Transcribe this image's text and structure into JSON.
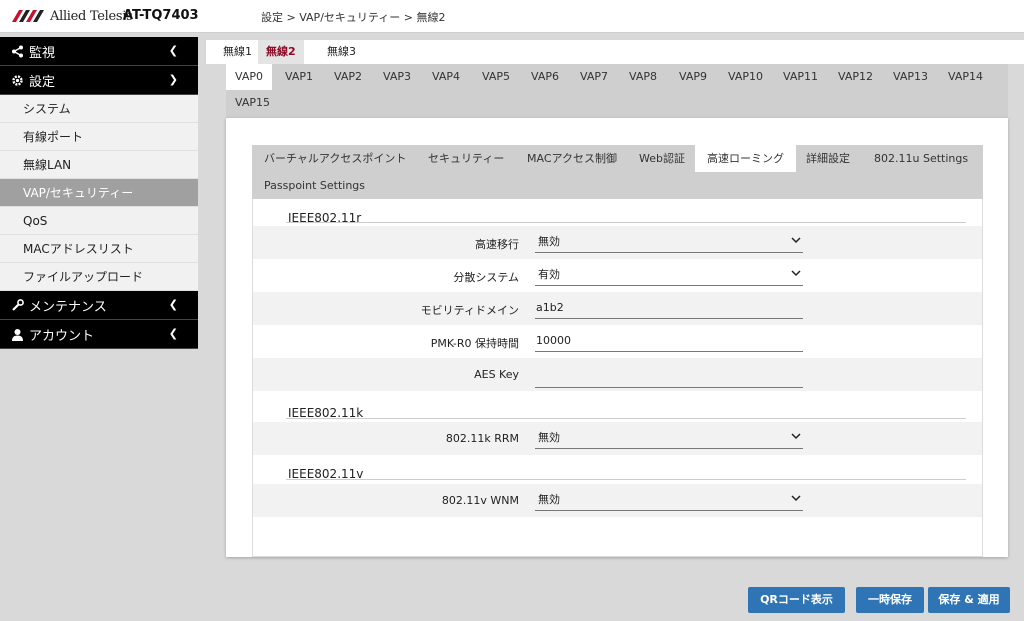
{
  "header": {
    "logo_text": "Allied Telesis",
    "model": "AT-TQ7403",
    "breadcrumb": "設定 > VAP/セキュリティー > 無線2"
  },
  "sidebar": {
    "groups": [
      {
        "label": "監視",
        "icon": "share-icon"
      },
      {
        "label": "設定",
        "icon": "gear-icon"
      },
      {
        "label": "メンテナンス",
        "icon": "wrench-icon"
      },
      {
        "label": "アカウント",
        "icon": "user-icon"
      }
    ],
    "items": [
      "システム",
      "有線ポート",
      "無線LAN",
      "VAP/セキュリティー",
      "QoS",
      "MACアドレスリスト",
      "ファイルアップロード"
    ],
    "active_item": "VAP/セキュリティー"
  },
  "radio_tabs": [
    "無線1",
    "無線2",
    "無線3"
  ],
  "active_radio": "無線2",
  "vap_tabs": [
    "VAP0",
    "VAP1",
    "VAP2",
    "VAP3",
    "VAP4",
    "VAP5",
    "VAP6",
    "VAP7",
    "VAP8",
    "VAP9",
    "VAP10",
    "VAP11",
    "VAP12",
    "VAP13",
    "VAP14",
    "VAP15"
  ],
  "active_vap": "VAP0",
  "sub_tabs": [
    "バーチャルアクセスポイント",
    "セキュリティー",
    "MACアクセス制御",
    "Web認証",
    "高速ローミング",
    "詳細設定",
    "802.11u Settings",
    "Passpoint Settings"
  ],
  "active_sub_tab": "高速ローミング",
  "sections": {
    "r": {
      "title": "IEEE802.11r",
      "fast_transition": {
        "label": "高速移行",
        "value": "無効"
      },
      "distributed_system": {
        "label": "分散システム",
        "value": "有効"
      },
      "mobility_domain": {
        "label": "モビリティドメイン",
        "value": "a1b2"
      },
      "pmk_r0": {
        "label": "PMK-R0 保持時間",
        "value": "10000"
      },
      "aes_key": {
        "label": "AES Key",
        "value": ""
      }
    },
    "k": {
      "title": "IEEE802.11k",
      "rrm": {
        "label": "802.11k RRM",
        "value": "無効"
      }
    },
    "v": {
      "title": "IEEE802.11v",
      "wnm": {
        "label": "802.11v WNM",
        "value": "無効"
      }
    }
  },
  "buttons": {
    "qr": "QRコード表示",
    "save": "一時保存",
    "apply": "保存 & 適用"
  },
  "colors": {
    "accent": "#2f74b5",
    "active_radio_text": "#8b0c25",
    "logo_red": "#c8102e"
  }
}
